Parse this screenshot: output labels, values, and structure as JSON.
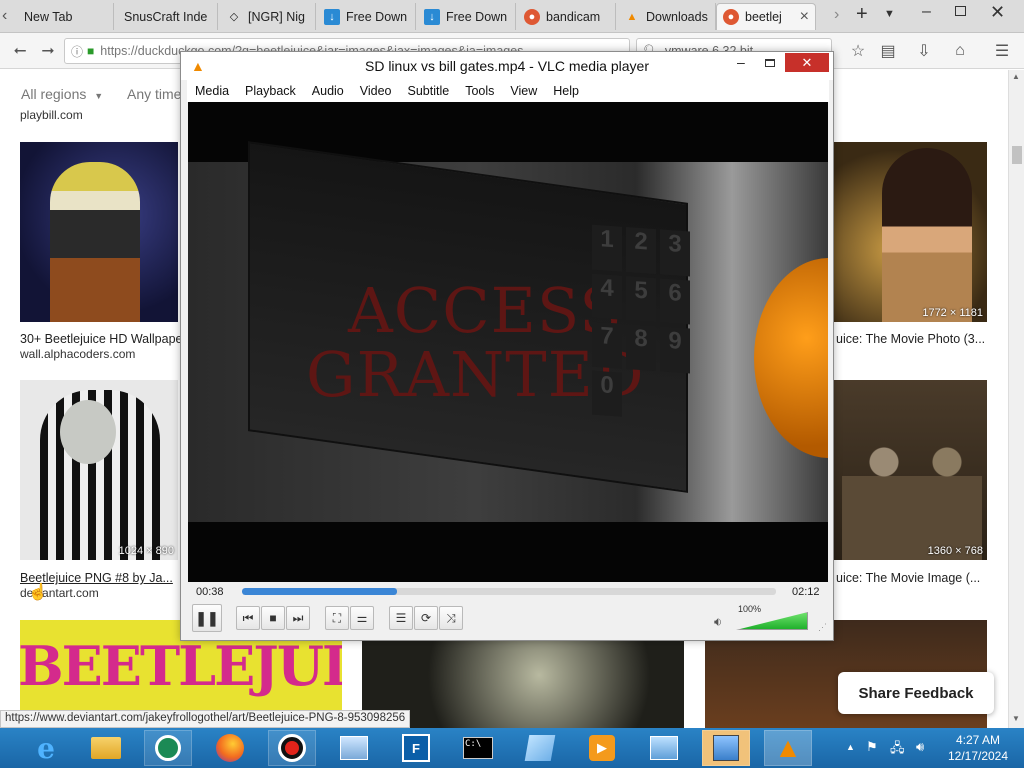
{
  "browser": {
    "tabs": [
      {
        "label": "New Tab",
        "icon": "page-icon"
      },
      {
        "label": "SnusCraft Inde",
        "icon": "page-icon"
      },
      {
        "label": "[NGR] Nig",
        "icon": "diamond-icon"
      },
      {
        "label": "Free Down",
        "icon": "download-icon"
      },
      {
        "label": "Free Down",
        "icon": "download-icon"
      },
      {
        "label": "bandicam",
        "icon": "duckduckgo-icon"
      },
      {
        "label": "Downloads",
        "icon": "vlc-cone-icon"
      },
      {
        "label": "beetlej",
        "icon": "duckduckgo-icon"
      }
    ],
    "url": "https://duckduckgo.com/?q=beetlejuice&iar=images&iax=images&ia=images",
    "search_value": "vmware 6.32 bit",
    "status_url": "https://www.deviantart.com/jakeyfrollogothel/art/Beetlejuice-PNG-8-953098256"
  },
  "page": {
    "filter_region": "All regions",
    "filter_time": "Any time",
    "top_source": "playbill.com",
    "cards": [
      {
        "title": "30+ Beetlejuice HD Wallpapers",
        "source": "wall.alphacoders.com",
        "dims": ""
      },
      {
        "title": "Beetlejuice: The Movie Photo (3...",
        "source": "",
        "dims": "1772 × 1181"
      },
      {
        "title": "Beetlejuice PNG #8 by Ja...",
        "source": "deviantart.com",
        "dims": "1024 × 890"
      },
      {
        "title": "Beetlejuice: The Movie Image (...",
        "source": "",
        "dims": "1360 × 768"
      }
    ],
    "bottom_banner_text": "BEETLEJUICE",
    "share_feedback": "Share Feedback"
  },
  "vlc": {
    "title": "SD linux vs bill gates.mp4 - VLC media player",
    "menu": [
      "Media",
      "Playback",
      "Audio",
      "Video",
      "Subtitle",
      "Tools",
      "View",
      "Help"
    ],
    "video_text_line1": "ACCESS",
    "video_text_line2": "GRANTED",
    "keypad": [
      "1",
      "2",
      "3",
      "4",
      "5",
      "6",
      "7",
      "8",
      "9",
      "0"
    ],
    "elapsed": "00:38",
    "total": "02:12",
    "progress": 0.29,
    "volume_label": "100%",
    "volume": 1.0
  },
  "taskbar": {
    "clock_time": "4:27 AM",
    "clock_date": "12/17/2024"
  },
  "colors": {
    "vlc_close": "#c7302a",
    "seek_fill": "#3b86d6",
    "taskbar": "#1d6fb1",
    "volume_fill": "#2ec43b",
    "access_red": "#5e1614"
  }
}
